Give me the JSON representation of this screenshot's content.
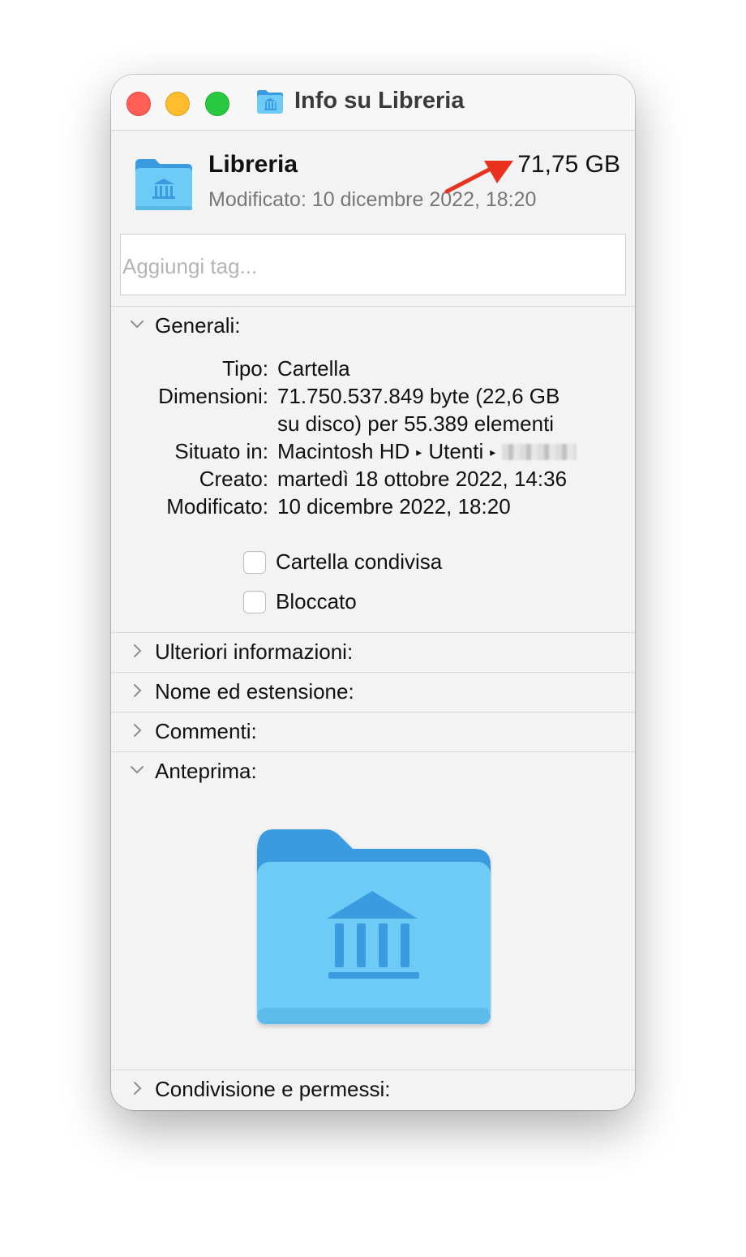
{
  "window": {
    "title": "Info su Libreria"
  },
  "header": {
    "name": "Libreria",
    "size": "71,75 GB",
    "modified": "Modificato: 10 dicembre 2022, 18:20"
  },
  "tags": {
    "placeholder": "Aggiungi tag..."
  },
  "general": {
    "label": "Generali:",
    "rows": {
      "tipo": {
        "label": "Tipo:",
        "value": "Cartella"
      },
      "dimensioni": {
        "label": "Dimensioni:",
        "value_line1": "71.750.537.849 byte (22,6 GB",
        "value_line2": "su disco) per 55.389 elementi"
      },
      "situato": {
        "label": "Situato in:",
        "path": [
          "Macintosh HD",
          "Utenti"
        ]
      },
      "creato": {
        "label": "Creato:",
        "value": "martedì 18 ottobre 2022, 14:36"
      },
      "modificato": {
        "label": "Modificato:",
        "value": "10 dicembre 2022, 18:20"
      }
    },
    "checkboxes": {
      "shared": {
        "label": "Cartella condivisa",
        "checked": false
      },
      "locked": {
        "label": "Bloccato",
        "checked": false
      }
    }
  },
  "sections": {
    "more_info": "Ulteriori informazioni:",
    "name_ext": "Nome ed estensione:",
    "comments": "Commenti:",
    "preview": "Anteprima:",
    "sharing": "Condivisione e permessi:"
  },
  "icons": {
    "folder": "library-folder-icon",
    "annotation": "red-arrow"
  },
  "colors": {
    "folder_blue": "#6ecbf6",
    "folder_dark": "#3a9be0",
    "arrow_red": "#e8321e"
  }
}
